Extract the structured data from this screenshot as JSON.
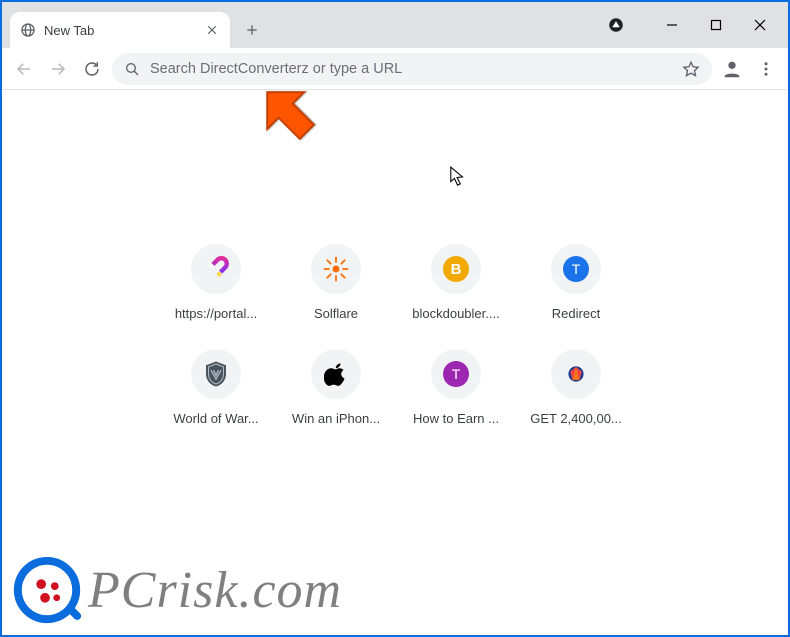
{
  "window": {
    "title": "New Tab"
  },
  "toolbar": {
    "omnibox_placeholder": "Search DirectConverterz or type a URL"
  },
  "shortcuts": [
    {
      "label": "https://portal...",
      "icon": "magnet"
    },
    {
      "label": "Solflare",
      "icon": "sun"
    },
    {
      "label": "blockdoubler....",
      "icon": "coin",
      "coin_letter": "B"
    },
    {
      "label": "Redirect",
      "icon": "letter",
      "letter": "T",
      "bg": "#1a73e8"
    },
    {
      "label": "World of War...",
      "icon": "shield"
    },
    {
      "label": "Win an iPhon...",
      "icon": "apple"
    },
    {
      "label": "How to Earn ...",
      "icon": "letter",
      "letter": "T",
      "bg": "#9c27b0"
    },
    {
      "label": "GET 2,400,00...",
      "icon": "diamond"
    }
  ],
  "watermark": {
    "text": "PCrisk.com"
  }
}
